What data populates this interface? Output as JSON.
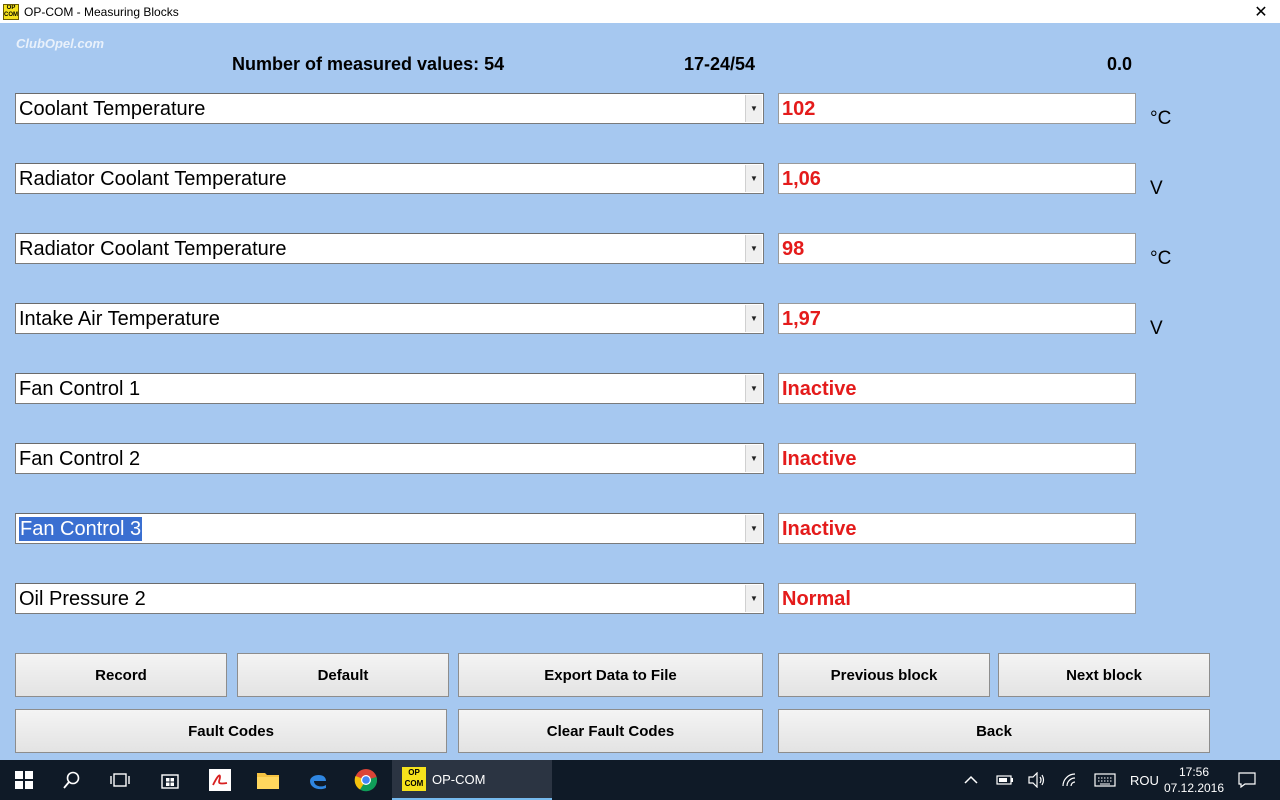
{
  "window": {
    "title": "OP-COM - Measuring Blocks",
    "app_icon_text": "OP COM",
    "close_glyph": "✕"
  },
  "watermark": "ClubOpel.com",
  "header": {
    "count_label": "Number of measured values: 54",
    "range_label": "17-24/54",
    "time_value": "0.0"
  },
  "rows": [
    {
      "parameter": "Coolant Temperature",
      "value": "102",
      "unit": "°C"
    },
    {
      "parameter": "Radiator Coolant Temperature",
      "value": "1,06",
      "unit": "V"
    },
    {
      "parameter": "Radiator Coolant Temperature",
      "value": "98",
      "unit": "°C"
    },
    {
      "parameter": "Intake Air Temperature",
      "value": "1,97",
      "unit": "V"
    },
    {
      "parameter": "Fan Control 1",
      "value": "Inactive",
      "unit": ""
    },
    {
      "parameter": "Fan Control 2",
      "value": "Inactive",
      "unit": ""
    },
    {
      "parameter": "Fan Control 3",
      "value": "Inactive",
      "unit": ""
    },
    {
      "parameter": "Oil Pressure 2",
      "value": "Normal",
      "unit": ""
    }
  ],
  "buttons": {
    "record": "Record",
    "default": "Default",
    "export": "Export Data to File",
    "previous": "Previous block",
    "next": "Next block",
    "fault_codes": "Fault Codes",
    "clear_fault_codes": "Clear Fault Codes",
    "back": "Back"
  },
  "taskbar": {
    "app_label": "OP-COM",
    "app_icon_text": "OP COM",
    "language": "ROU",
    "time": "17:56",
    "date": "07.12.2016"
  },
  "colors": {
    "background": "#a6c8f0",
    "value_text": "#e41b1b",
    "taskbar": "#0f1a27"
  }
}
